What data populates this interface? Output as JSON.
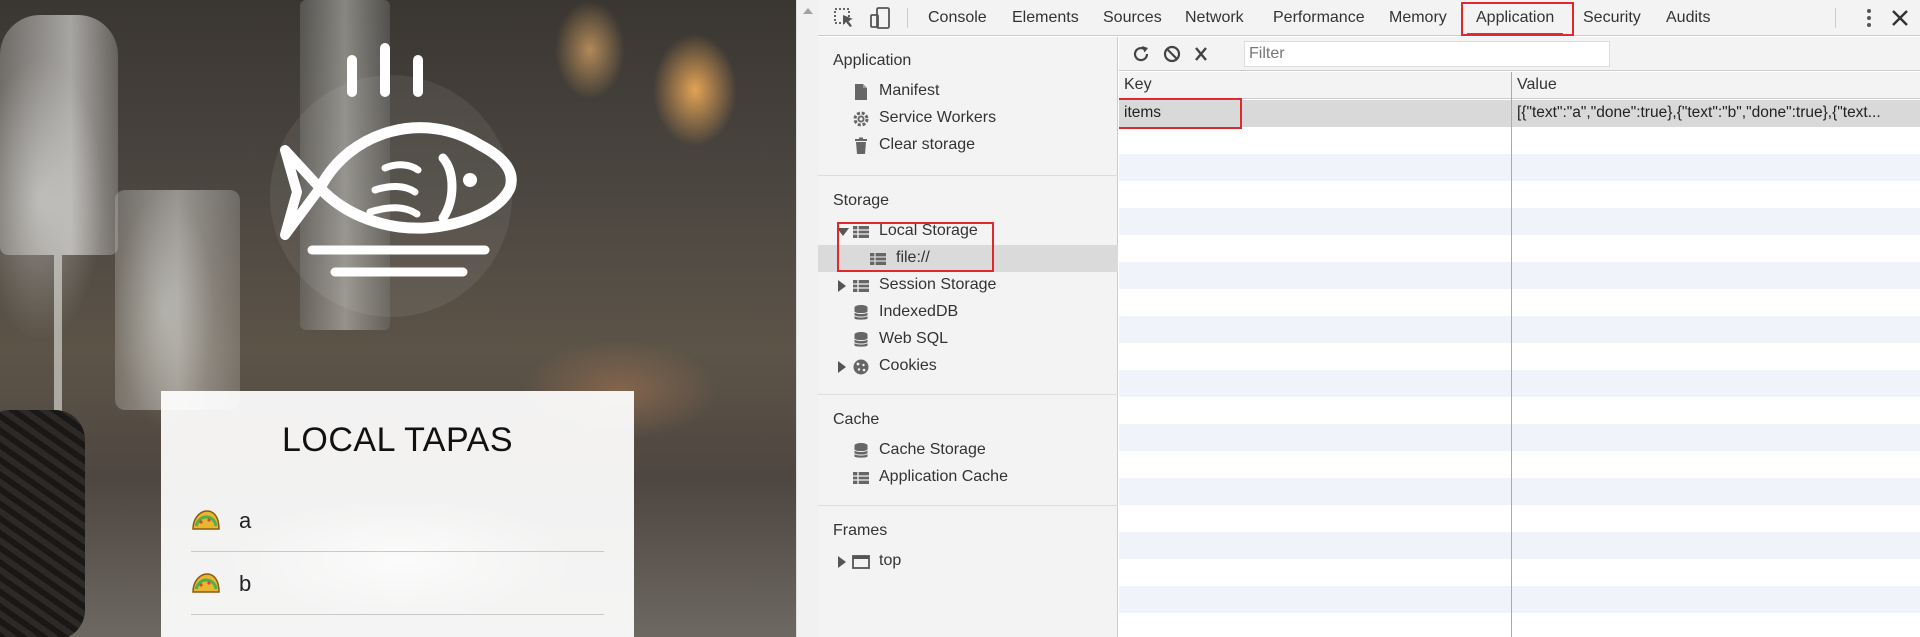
{
  "page": {
    "app_title": "LOCAL TAPAS",
    "tapas": [
      {
        "text": "a",
        "icon": "taco-icon"
      },
      {
        "text": "b",
        "icon": "taco-icon"
      }
    ]
  },
  "devtools": {
    "tabs": [
      "Console",
      "Elements",
      "Sources",
      "Network",
      "Performance",
      "Memory",
      "Application",
      "Security",
      "Audits"
    ],
    "active_tab": "Application",
    "sidebar": {
      "application_title": "Application",
      "application_items": [
        "Manifest",
        "Service Workers",
        "Clear storage"
      ],
      "storage_title": "Storage",
      "storage_items": {
        "local_storage": "Local Storage",
        "local_storage_child": "file://",
        "session_storage": "Session Storage",
        "indexeddb": "IndexedDB",
        "web_sql": "Web SQL",
        "cookies": "Cookies"
      },
      "cache_title": "Cache",
      "cache_items": [
        "Cache Storage",
        "Application Cache"
      ],
      "frames_title": "Frames",
      "frames_items": [
        "top"
      ]
    },
    "main": {
      "filter_placeholder": "Filter",
      "columns": [
        "Key",
        "Value"
      ],
      "rows": [
        {
          "key": "items",
          "value": "[{\"text\":\"a\",\"done\":true},{\"text\":\"b\",\"done\":true},{\"text..."
        }
      ]
    }
  },
  "colors": {
    "highlight": "#e0282e",
    "accent": "#1a73e8"
  }
}
